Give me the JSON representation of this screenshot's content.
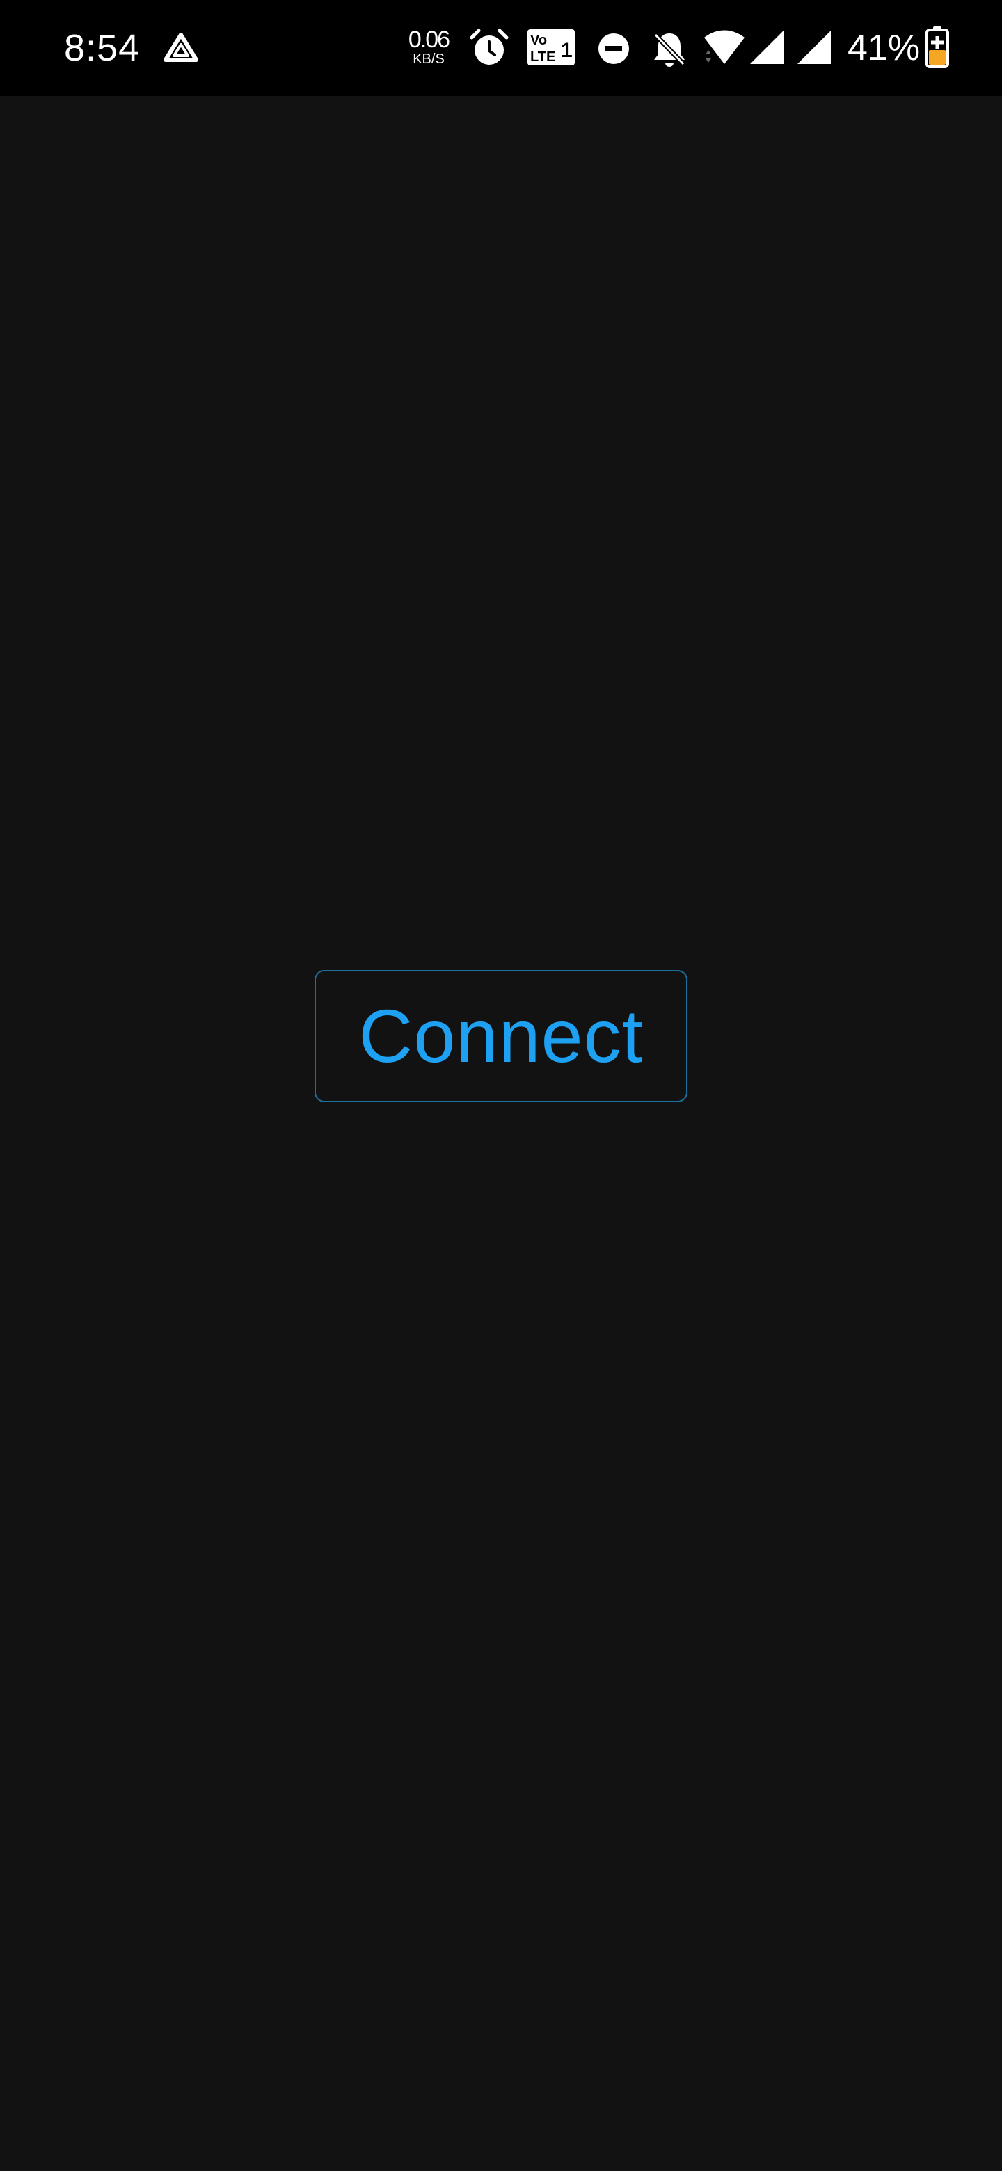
{
  "status_bar": {
    "time": "8:54",
    "network_speed_value": "0.06",
    "network_speed_unit": "KB/S",
    "volte_top": "Vo",
    "volte_bottom": "LTE",
    "volte_sim": "1",
    "battery_percent": "41%",
    "icons": [
      "drive-icon",
      "alarm-icon",
      "volte-icon",
      "do-not-disturb-icon",
      "bell-off-icon",
      "wifi-icon",
      "signal-icon",
      "signal-icon",
      "battery-charging-icon"
    ]
  },
  "main": {
    "connect_label": "Connect"
  },
  "colors": {
    "background": "#121212",
    "status_bar": "#000000",
    "accent": "#1ea1f2",
    "button_border": "#1e6f9e",
    "battery_fill": "#f5a623"
  }
}
